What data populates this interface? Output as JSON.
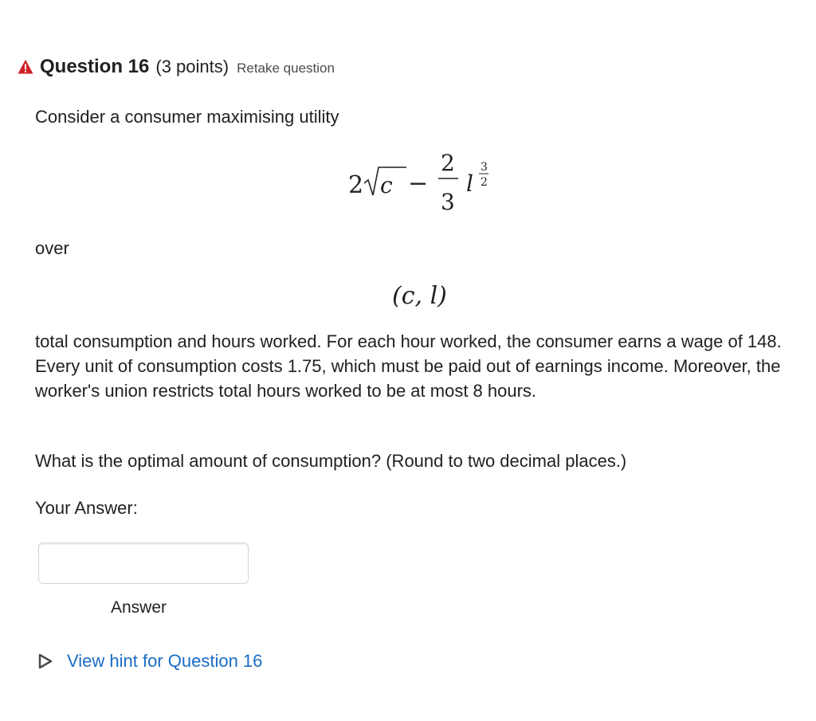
{
  "header": {
    "title": "Question 16",
    "points": "(3 points)",
    "retake_label": "Retake question",
    "warning_color": "#cd2026"
  },
  "question": {
    "intro": "Consider a consumer maximising utility",
    "over": "over",
    "body": "total consumption and hours worked. For each hour worked, the consumer earns a wage of 148. Every unit of consumption costs 1.75, which must be paid out of earnings income. Moreover, the worker's union restricts total hours worked to be at most 8 hours.",
    "prompt": "What is the optimal amount of consumption? (Round to two decimal places.)"
  },
  "math": {
    "coef": "2",
    "var_c": "c",
    "minus": "−",
    "frac_num": "2",
    "frac_den": "3",
    "var_l": "l",
    "exp_num": "3",
    "exp_den": "2",
    "pair": "(c, l)"
  },
  "answer": {
    "your_answer_label": "Your Answer:",
    "value": "",
    "placeholder": "",
    "answer_label": "Answer"
  },
  "hint": {
    "label": "View hint for Question 16",
    "link_color": "#1c6cc4"
  }
}
